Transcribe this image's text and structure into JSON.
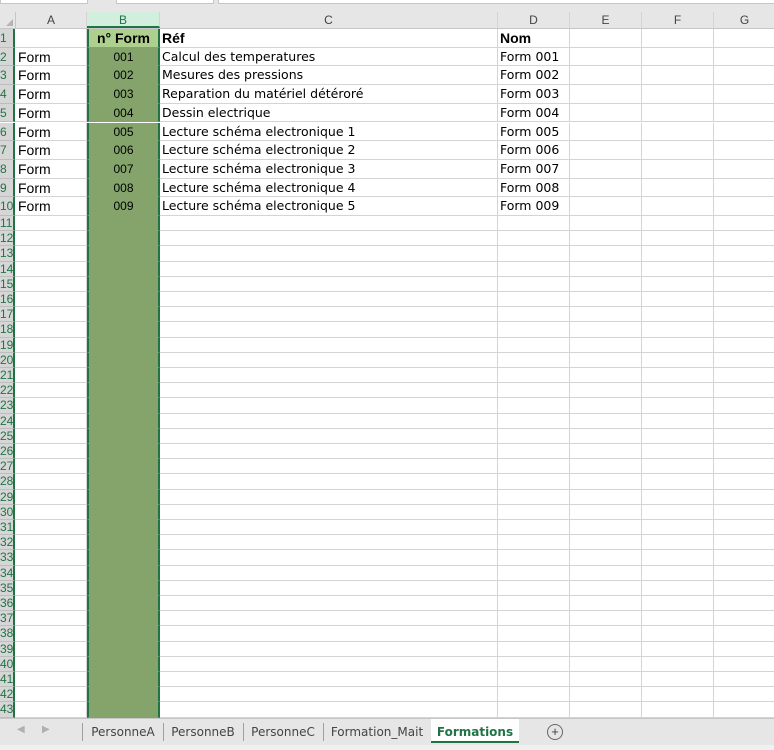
{
  "columns": [
    "A",
    "B",
    "C",
    "D",
    "E",
    "F",
    "G"
  ],
  "selected_column": "B",
  "header_row": {
    "A": "",
    "B": "n° Form",
    "C": "Réf",
    "D": "Nom"
  },
  "rows": [
    {
      "num": "1"
    },
    {
      "num": "2",
      "A": "Form",
      "B": "001",
      "C": "Calcul des temperatures",
      "D": "Form 001"
    },
    {
      "num": "3",
      "A": "Form",
      "B": "002",
      "C": "Mesures des pressions",
      "D": "Form 002"
    },
    {
      "num": "4",
      "A": "Form",
      "B": "003",
      "C": "Reparation du matériel détéroré",
      "D": "Form 003"
    },
    {
      "num": "5",
      "A": "Form",
      "B": "004",
      "C": "Dessin electrique",
      "D": "Form 004"
    },
    {
      "num": "6",
      "A": "Form",
      "B": "005",
      "C": "Lecture schéma electronique 1",
      "D": "Form 005"
    },
    {
      "num": "7",
      "A": "Form",
      "B": "006",
      "C": "Lecture schéma electronique 2",
      "D": "Form 006"
    },
    {
      "num": "8",
      "A": "Form",
      "B": "007",
      "C": "Lecture schéma electronique 3",
      "D": "Form 007"
    },
    {
      "num": "9",
      "A": "Form",
      "B": "008",
      "C": "Lecture schéma electronique 4",
      "D": "Form 008"
    },
    {
      "num": "10",
      "A": "Form",
      "B": "009",
      "C": "Lecture schéma electronique 5",
      "D": "Form 009"
    }
  ],
  "empty_row_start": 11,
  "empty_row_end": 43,
  "sheet_tabs": [
    {
      "label": "PersonneA",
      "active": false
    },
    {
      "label": "PersonneB",
      "active": false
    },
    {
      "label": "PersonneC",
      "active": false
    },
    {
      "label": "Formation_Mait",
      "active": false
    },
    {
      "label": "Formations",
      "active": true
    }
  ],
  "add_sheet_symbol": "+",
  "nav_prev_symbol": "◀",
  "nav_next_symbol": "▶",
  "colors": {
    "accent": "#217346",
    "selected_fill": "#84a46c",
    "header_fill": "#aed08e"
  }
}
